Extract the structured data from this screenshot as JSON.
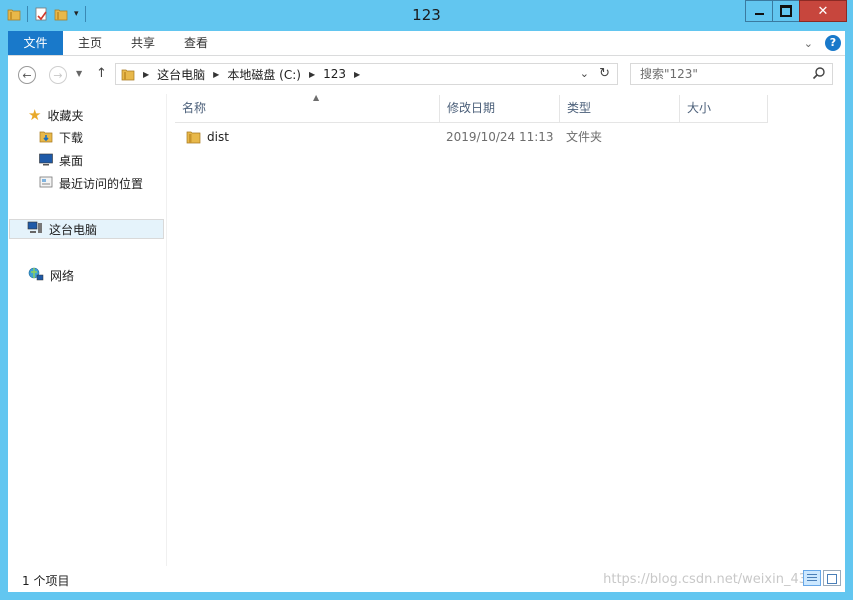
{
  "window": {
    "title": "123"
  },
  "ribbon": {
    "tabs": [
      {
        "label": "文件"
      },
      {
        "label": "主页"
      },
      {
        "label": "共享"
      },
      {
        "label": "查看"
      }
    ]
  },
  "address": {
    "crumbs": [
      "这台电脑",
      "本地磁盘 (C:)",
      "123"
    ],
    "search_placeholder": "搜索\"123\""
  },
  "navpane": {
    "favorites": {
      "label": "收藏夹",
      "icon": "star-icon"
    },
    "favorites_items": [
      {
        "label": "下载",
        "icon": "downloads-folder-icon"
      },
      {
        "label": "桌面",
        "icon": "desktop-icon"
      },
      {
        "label": "最近访问的位置",
        "icon": "recent-places-icon"
      }
    ],
    "this_pc": {
      "label": "这台电脑",
      "icon": "computer-icon"
    },
    "network": {
      "label": "网络",
      "icon": "network-icon"
    }
  },
  "columns": [
    {
      "label": "名称"
    },
    {
      "label": "修改日期"
    },
    {
      "label": "类型"
    },
    {
      "label": "大小"
    }
  ],
  "files": [
    {
      "name": "dist",
      "modified": "2019/10/24 11:13",
      "type": "文件夹",
      "size": ""
    }
  ],
  "status": {
    "count": "1 个项目"
  },
  "watermark": "https://blog.csdn.net/weixin_43",
  "colors": {
    "accent": "#1979ca",
    "titlebar": "#62c6f0",
    "close": "#c7463d",
    "folder": "#e8b84a"
  }
}
